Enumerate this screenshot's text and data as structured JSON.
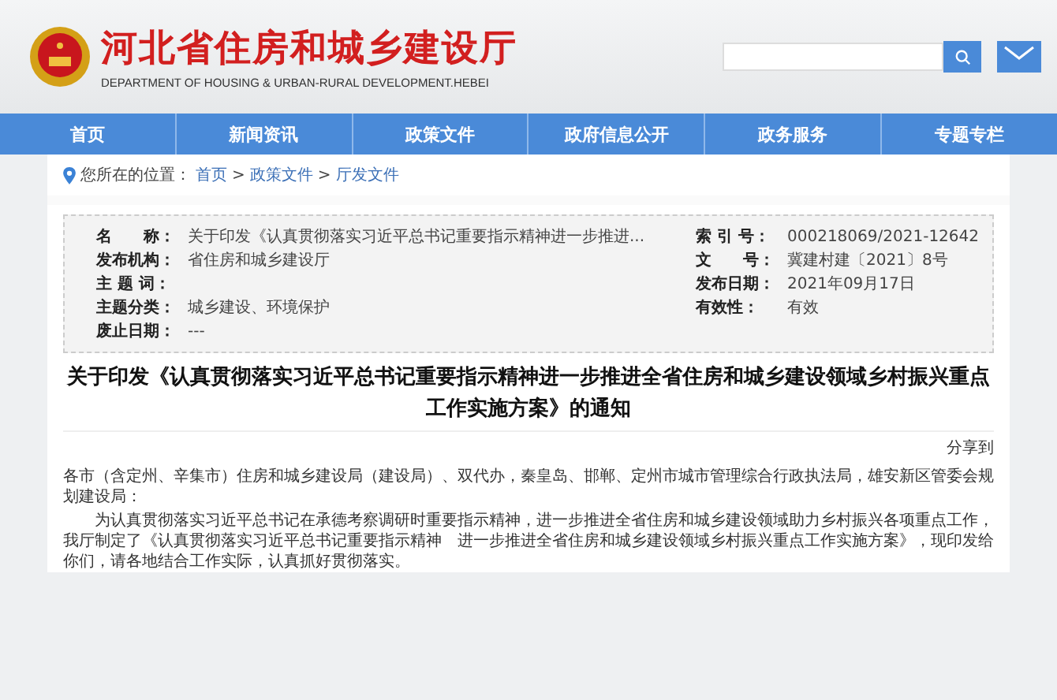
{
  "header": {
    "title": "河北省住房和城乡建设厅",
    "subtitle": "DEPARTMENT OF HOUSING & URBAN-RURAL DEVELOPMENT.HEBEI"
  },
  "nav": [
    "首页",
    "新闻资讯",
    "政策文件",
    "政府信息公开",
    "政务服务",
    "专题专栏"
  ],
  "breadcrumb": {
    "label": "您所在的位置：",
    "separator": ">",
    "items": [
      "首页",
      "政策文件",
      "厅发文件"
    ]
  },
  "meta": [
    {
      "label": "名　　称：",
      "value": "关于印发《认真贯彻落实习近平总书记重要指示精神进一步推进..."
    },
    {
      "label": "索 引 号：",
      "value": "000218069/2021-12642"
    },
    {
      "label": "发布机构：",
      "value": "省住房和城乡建设厅"
    },
    {
      "label": "文　　号：",
      "value": "冀建村建〔2021〕8号"
    },
    {
      "label": "主 题 词："
    },
    {
      "label": "发布日期：",
      "value": "2021年09月17日"
    },
    {
      "label": "主题分类：",
      "value": "城乡建设、环境保护"
    },
    {
      "label": "有效性：",
      "value": "有效"
    },
    {
      "label": "废止日期：",
      "value": "---"
    }
  ],
  "article": {
    "title": "关于印发《认真贯彻落实习近平总书记重要指示精神进一步推进全省住房和城乡建设领域乡村振兴重点工作实施方案》的通知",
    "share": "分享到",
    "paragraphs": [
      "各市（含定州、辛集市）住房和城乡建设局（建设局）、双代办，秦皇岛、邯郸、定州市城市管理综合行政执法局，雄安新区管委会规划建设局：",
      "为认真贯彻落实习近平总书记在承德考察调研时重要指示精神，进一步推进全省住房和城乡建设领域助力乡村振兴各项重点工作，我厅制定了《认真贯彻落实习近平总书记重要指示精神　进一步推进全省住房和城乡建设领域乡村振兴重点工作实施方案》，现印发给你们，请各地结合工作实际，认真抓好贯彻落实。"
    ]
  }
}
